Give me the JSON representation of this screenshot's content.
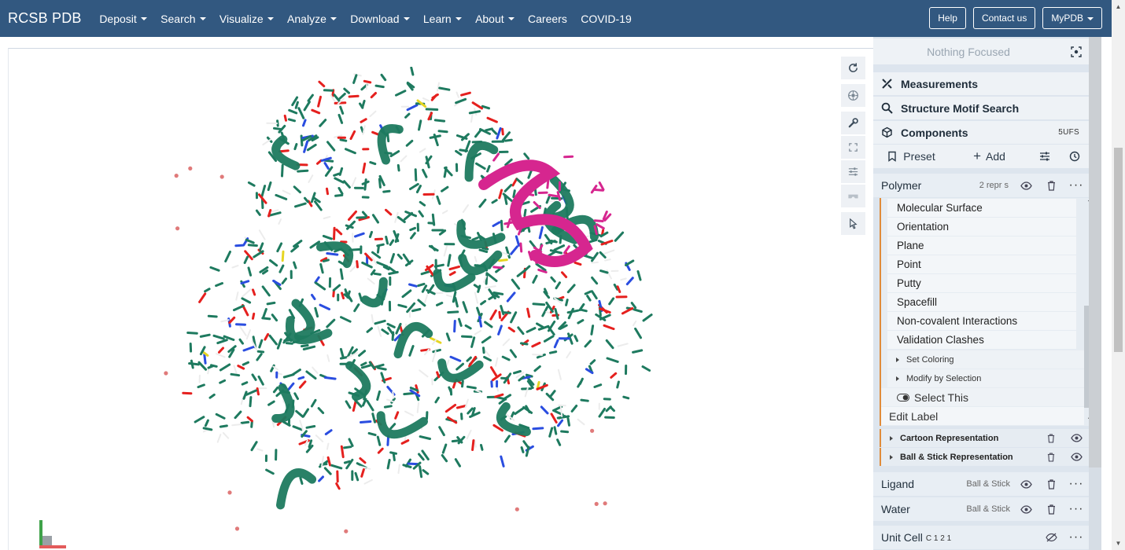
{
  "nav": {
    "brand": "RCSB PDB",
    "items": [
      {
        "label": "Deposit",
        "dropdown": true
      },
      {
        "label": "Search",
        "dropdown": true
      },
      {
        "label": "Visualize",
        "dropdown": true
      },
      {
        "label": "Analyze",
        "dropdown": true
      },
      {
        "label": "Download",
        "dropdown": true
      },
      {
        "label": "Learn",
        "dropdown": true
      },
      {
        "label": "About",
        "dropdown": true
      },
      {
        "label": "Careers",
        "dropdown": false
      },
      {
        "label": "COVID-19",
        "dropdown": false
      }
    ],
    "help": "Help",
    "contact": "Contact us",
    "mypdb": "MyPDB"
  },
  "viewer": {
    "tools": [
      "rotate-icon",
      "target-icon",
      "wrench-icon",
      "expand-icon",
      "sliders-icon",
      "vr-icon",
      "cursor-icon"
    ],
    "colors": {
      "helix": "#1e7a5f",
      "highlight": "#d6268f",
      "oxygen": "#e5201e",
      "nitrogen": "#2a4de0",
      "hydrogen": "#ececec",
      "sulfur": "#e6d522",
      "water": "#e07a7a"
    }
  },
  "panel": {
    "focus": "Nothing Focused",
    "measurements": "Measurements",
    "motif": "Structure Motif Search",
    "components": "Components",
    "components_id": "5UFS",
    "preset": "Preset",
    "add": "Add",
    "polymer": {
      "name": "Polymer",
      "reprs": "2 repr s"
    },
    "options": [
      "Molecular Surface",
      "Orientation",
      "Plane",
      "Point",
      "Putty",
      "Spacefill",
      "Non-covalent Interactions",
      "Validation Clashes"
    ],
    "set_coloring": "Set Coloring",
    "modify_selection": "Modify by Selection",
    "select_this": "Select This",
    "edit_label": "Edit Label",
    "cartoon": "Cartoon Representation",
    "ball_stick": "Ball & Stick Representation",
    "ligand": {
      "name": "Ligand",
      "repr": "Ball & Stick"
    },
    "water": {
      "name": "Water",
      "repr": "Ball & Stick"
    },
    "unit_cell": {
      "name": "Unit Cell",
      "spacegroup": "C 1 2 1"
    }
  }
}
